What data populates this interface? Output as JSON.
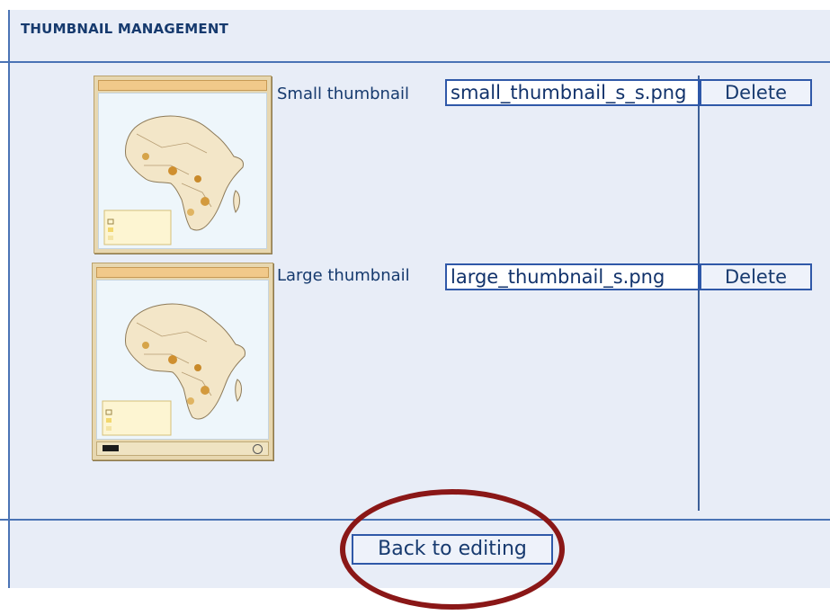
{
  "header": {
    "title": "THUMBNAIL MANAGEMENT"
  },
  "thumbnails": [
    {
      "label": "Small thumbnail",
      "filename": "small_thumbnail_s_s.png",
      "delete_label": "Delete"
    },
    {
      "label": "Large thumbnail",
      "filename": "large_thumbnail_s.png",
      "delete_label": "Delete"
    }
  ],
  "footer": {
    "back_label": "Back to editing"
  },
  "colors": {
    "panel_bg": "#e8edf7",
    "border": "#4a73b5",
    "text": "#163a6e",
    "annotation": "#8a1717"
  }
}
